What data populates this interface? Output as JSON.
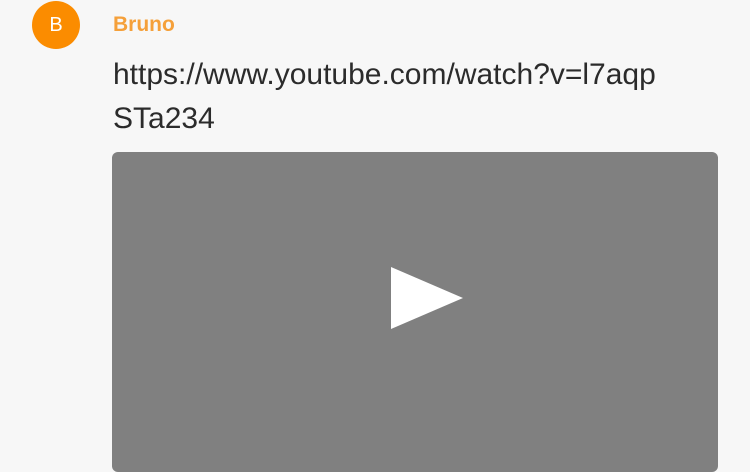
{
  "message": {
    "avatar_initial": "B",
    "author": "Bruno",
    "text": "https://www.youtube.com/watch?v=l7aqpSTa234",
    "embed_icon": "play-icon"
  },
  "colors": {
    "avatar_bg": "#fb8c00",
    "author_name": "#f5a03a",
    "embed_bg": "#808080"
  }
}
